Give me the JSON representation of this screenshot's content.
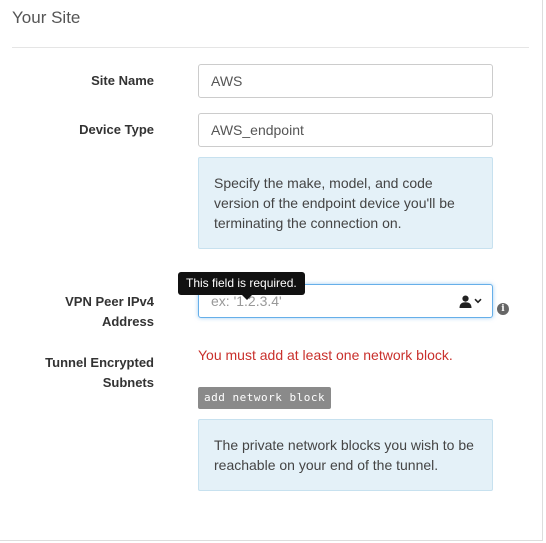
{
  "section": {
    "title": "Your Site"
  },
  "fields": {
    "site_name": {
      "label": "Site Name",
      "value": "AWS"
    },
    "device_type": {
      "label": "Device Type",
      "value": "AWS_endpoint",
      "help": "Specify the make, model, and code version of the endpoint device you'll be terminating the connection on."
    },
    "vpn_peer": {
      "label_line1": "VPN Peer IPv4",
      "label_line2": "Address",
      "placeholder": "ex: '1.2.3.4'",
      "tooltip": "This field is required."
    },
    "tunnel_subnets": {
      "label_line1": "Tunnel Encrypted",
      "label_line2": "Subnets",
      "error": "You must add at least one network block.",
      "button_label": "add network block",
      "help": "The private network blocks you wish to be reachable on your end of the tunnel."
    }
  },
  "icons": {
    "user": "user-icon",
    "dropdown": "chevron-down-icon",
    "info": "info-icon"
  },
  "colors": {
    "error": "#c9302c",
    "help_background": "#e4f1f8",
    "focus_border": "#66afe9",
    "button_background": "#8a8a8a"
  }
}
